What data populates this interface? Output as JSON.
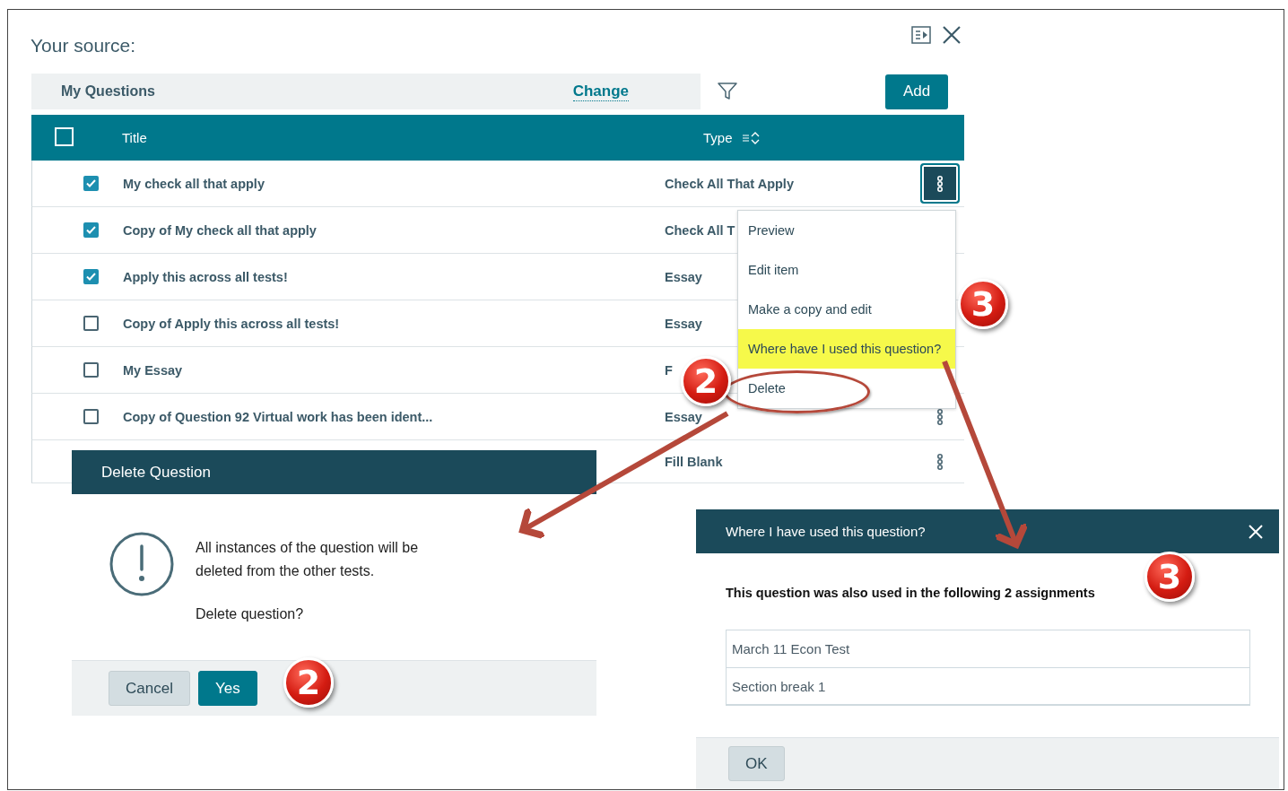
{
  "header": {
    "title": "Your source:"
  },
  "source_bar": {
    "label": "My Questions",
    "link": "Change",
    "button": "Add"
  },
  "table": {
    "columns": [
      "Title",
      "Type"
    ],
    "select_all_checked": false,
    "rows": [
      {
        "title": "My check all that apply",
        "type": "Check All That Apply",
        "checked": true,
        "menu_open": true
      },
      {
        "title": "Copy of My check all that apply",
        "type": "Check All T",
        "checked": true
      },
      {
        "title": "Apply this across all tests!",
        "type": "Essay",
        "checked": true
      },
      {
        "title": "Copy of Apply this across all tests!",
        "type": "Essay",
        "checked": false
      },
      {
        "title": "My Essay",
        "type": "F",
        "checked": false
      },
      {
        "title": "Copy of Question 92 Virtual work has been ident...",
        "type": "Essay",
        "checked": false,
        "menu_open": false
      },
      {
        "type": "Fill Blank",
        "menu_open": false
      }
    ]
  },
  "context_menu": {
    "items": [
      {
        "label": "Preview",
        "highlighted": false,
        "circled": false
      },
      {
        "label": "Edit item",
        "highlighted": false,
        "circled": false
      },
      {
        "label": "Make a copy and edit",
        "highlighted": false,
        "circled": false
      },
      {
        "label": "Where have I used this question?",
        "highlighted": true,
        "circled": false
      },
      {
        "label": "Delete",
        "highlighted": false,
        "circled": true
      }
    ]
  },
  "delete_dialog": {
    "title": "Delete Question",
    "message": "All instances of the question will be deleted from the other tests.",
    "question": "Delete question?",
    "buttons": [
      {
        "label": "Cancel",
        "kind": "secondary"
      },
      {
        "label": "Yes",
        "kind": "primary"
      }
    ]
  },
  "usage_dialog": {
    "title": "Where I have used this question?",
    "summary": "This question was also used in the following 2 assignments",
    "assignments": [
      "March 11 Econ Test",
      "Section break 1"
    ],
    "button": "OK"
  },
  "callouts": [
    {
      "number": "2"
    },
    {
      "number": "3"
    },
    {
      "number": "2"
    },
    {
      "number": "3"
    }
  ]
}
